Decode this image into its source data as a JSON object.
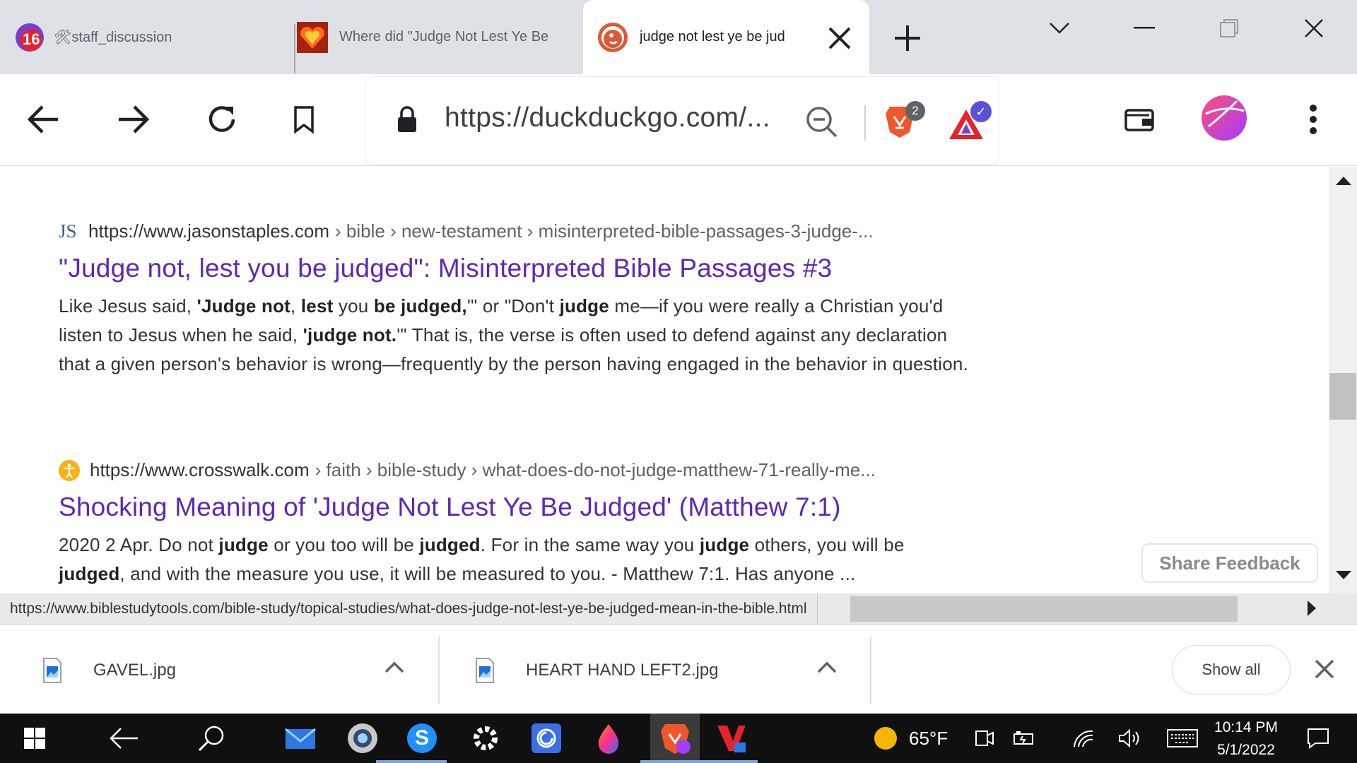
{
  "tabs": {
    "tab1": {
      "title": "🛠staff_discussion",
      "badge": "16"
    },
    "tab2": {
      "title": "Where did \"Judge Not Lest Ye Be"
    },
    "tab3": {
      "title": "judge not lest ye be jud"
    }
  },
  "toolbar": {
    "url": "https://duckduckgo.com/...",
    "brave_shield_count": "2"
  },
  "results": [
    {
      "favicon_text": "JS",
      "site": "https://www.jasonstaples.com",
      "crumbs": "› bible › new-testament › misinterpreted-bible-passages-3-judge-...",
      "title": "\"Judge not, lest you be judged\": Misinterpreted Bible Passages #3",
      "snippet_html": "Like Jesus said, <b>'Judge not</b>, <b>lest</b> you <b>be judged,</b>'\" or \"Don't <b>judge</b> me—if you were really a Christian you'd listen to Jesus when he said, <b>'judge not.</b>'\" That is, the verse is often used to defend against any declaration that a given person's behavior is wrong—frequently by the person having engaged in the behavior in question."
    },
    {
      "favicon_text": "",
      "site": "https://www.crosswalk.com",
      "crumbs": "› faith › bible-study › what-does-do-not-judge-matthew-71-really-me...",
      "title": "Shocking Meaning of 'Judge Not Lest Ye Be Judged' (Matthew 7:1)",
      "snippet_html": "2020 2 Apr. Do not <b>judge</b> or you too will be <b>judged</b>. For in the same way you <b>judge</b> others, you will be <b>judged</b>, and with the measure you use, it will be measured to you. - Matthew 7:1. Has anyone ..."
    }
  ],
  "feedback_label": "Share Feedback",
  "status_url": "https://www.biblestudytools.com/bible-study/topical-studies/what-does-judge-not-lest-ye-be-judged-mean-in-the-bible.html",
  "downloads": {
    "items": [
      {
        "name": "GAVEL.jpg"
      },
      {
        "name": "HEART HAND LEFT2.jpg"
      }
    ],
    "show_all": "Show all"
  },
  "taskbar": {
    "skype_letter": "S",
    "temperature": "65°F",
    "time": "10:14 PM",
    "date": "5/1/2022"
  },
  "colors": {
    "result_title": "#5c28b6",
    "tab_strip": "#dee1e6",
    "taskbar": "#101010"
  }
}
